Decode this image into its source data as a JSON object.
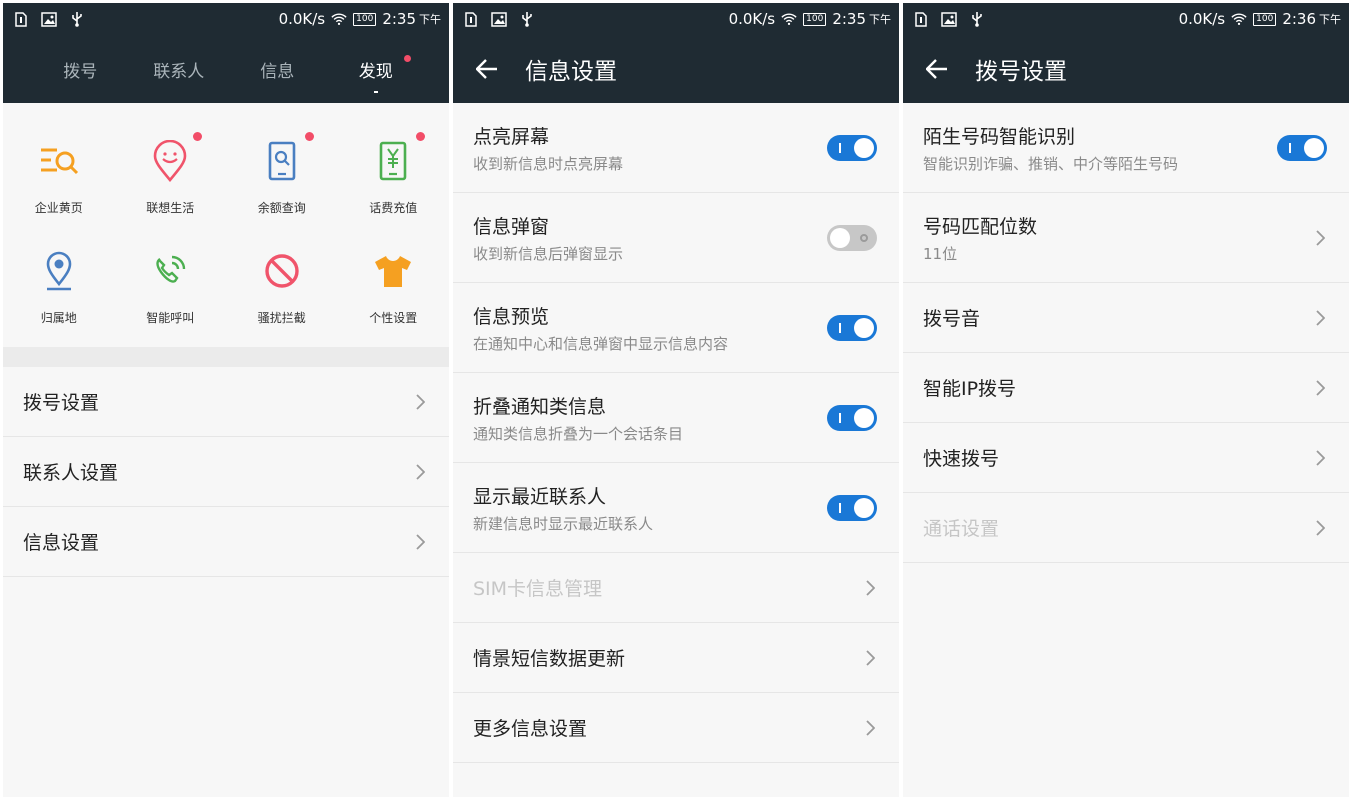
{
  "screens": [
    {
      "status": {
        "speed": "0.0K/s",
        "battery": "100",
        "time": "2:35",
        "ampm": "下午"
      },
      "tabs": [
        {
          "label": "拨号",
          "active": false
        },
        {
          "label": "联系人",
          "active": false
        },
        {
          "label": "信息",
          "active": false
        },
        {
          "label": "发现",
          "active": true
        }
      ],
      "grid": [
        {
          "label": "企业黄页",
          "icon": "yellow-pages-icon",
          "color": "#f5a021",
          "badge": false
        },
        {
          "label": "联想生活",
          "icon": "smiley-pin-icon",
          "color": "#f0546b",
          "badge": true
        },
        {
          "label": "余额查询",
          "icon": "balance-search-icon",
          "color": "#4a7fc1",
          "badge": true
        },
        {
          "label": "话费充值",
          "icon": "recharge-phone-icon",
          "color": "#4caf50",
          "badge": true
        },
        {
          "label": "归属地",
          "icon": "location-pin-icon",
          "color": "#4a7fc1",
          "badge": false
        },
        {
          "label": "智能呼叫",
          "icon": "smart-call-icon",
          "color": "#4caf50",
          "badge": false
        },
        {
          "label": "骚扰拦截",
          "icon": "block-icon",
          "color": "#f0546b",
          "badge": false
        },
        {
          "label": "个性设置",
          "icon": "tshirt-icon",
          "color": "#f5a021",
          "badge": false
        }
      ],
      "list": [
        {
          "title": "拨号设置"
        },
        {
          "title": "联系人设置"
        },
        {
          "title": "信息设置"
        }
      ]
    },
    {
      "status": {
        "speed": "0.0K/s",
        "battery": "100",
        "time": "2:35",
        "ampm": "下午"
      },
      "title": "信息设置",
      "rows": [
        {
          "title": "点亮屏幕",
          "subtitle": "收到新信息时点亮屏幕",
          "toggle": "on"
        },
        {
          "title": "信息弹窗",
          "subtitle": "收到新信息后弹窗显示",
          "toggle": "off"
        },
        {
          "title": "信息预览",
          "subtitle": "在通知中心和信息弹窗中显示信息内容",
          "toggle": "on"
        },
        {
          "title": "折叠通知类信息",
          "subtitle": "通知类信息折叠为一个会话条目",
          "toggle": "on"
        },
        {
          "title": "显示最近联系人",
          "subtitle": "新建信息时显示最近联系人",
          "toggle": "on"
        },
        {
          "title": "SIM卡信息管理",
          "disabled": true
        },
        {
          "title": "情景短信数据更新"
        },
        {
          "title": "更多信息设置"
        }
      ]
    },
    {
      "status": {
        "speed": "0.0K/s",
        "battery": "100",
        "time": "2:36",
        "ampm": "下午"
      },
      "title": "拨号设置",
      "rows": [
        {
          "title": "陌生号码智能识别",
          "subtitle": "智能识别诈骗、推销、中介等陌生号码",
          "toggle": "on"
        },
        {
          "title": "号码匹配位数",
          "subtitle": "11位"
        },
        {
          "title": "拨号音"
        },
        {
          "title": "智能IP拨号"
        },
        {
          "title": "快速拨号"
        },
        {
          "title": "通话设置",
          "disabled": true
        }
      ]
    }
  ]
}
